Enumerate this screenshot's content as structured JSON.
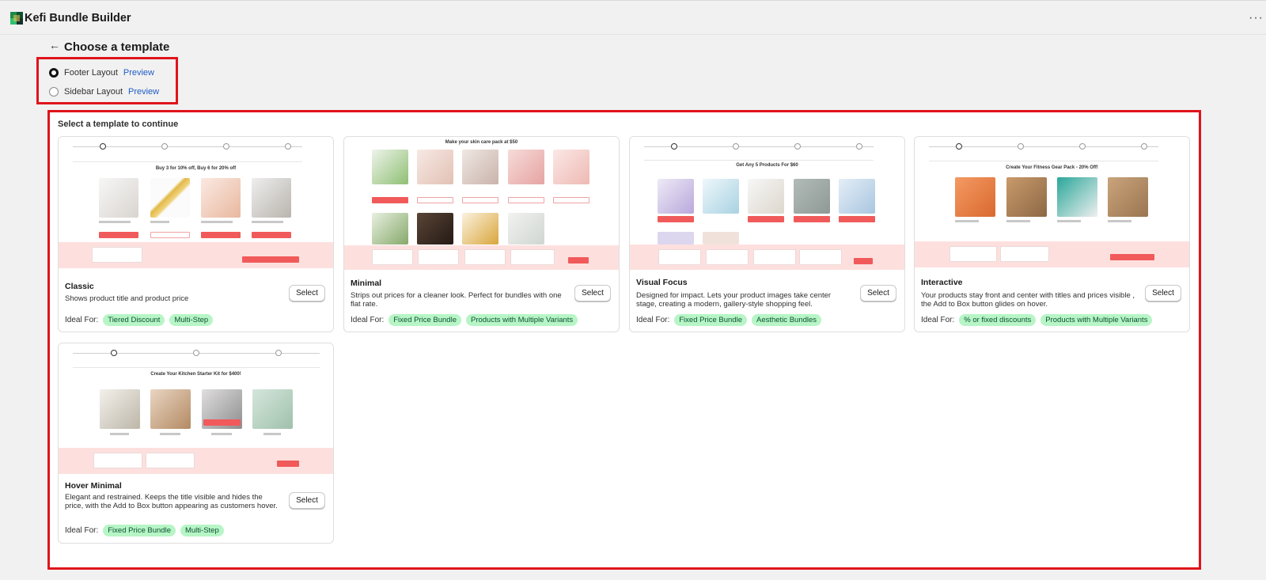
{
  "app": {
    "title": "Kefi Bundle Builder"
  },
  "page": {
    "title": "Choose a template"
  },
  "layout_options": [
    {
      "label": "Footer Layout",
      "preview": "Preview",
      "selected": true
    },
    {
      "label": "Sidebar Layout",
      "preview": "Preview",
      "selected": false
    }
  ],
  "section_label": "Select a template to continue",
  "ideal_for_label": "Ideal For:",
  "select_label": "Select",
  "cards": [
    {
      "title": "Classic",
      "desc": "Shows product title and product price",
      "tags": [
        "Tiered Discount",
        "Multi-Step"
      ],
      "thumb_heading": "Buy 3 for 10% off, Buy 6 for 20% off"
    },
    {
      "title": "Minimal",
      "desc": "Strips out prices for a cleaner look. Perfect for bundles with one flat rate.",
      "tags": [
        "Fixed Price Bundle",
        "Products with Multiple Variants"
      ],
      "thumb_heading": "Make your skin care pack at $50"
    },
    {
      "title": "Visual Focus",
      "desc": "Designed for impact. Lets your product images take center stage, creating a modern, gallery-style shopping feel.",
      "tags": [
        "Fixed Price Bundle",
        "Aesthetic Bundles"
      ],
      "thumb_heading": "Get Any 5 Products For $60"
    },
    {
      "title": "Interactive",
      "desc": "Your products stay front and center with titles and prices visible , the Add to Box button glides on hover.",
      "tags": [
        "% or fixed discounts",
        "Products with Multiple Variants"
      ],
      "thumb_heading": "Create Your Fitness Gear Pack - 20% Off!"
    },
    {
      "title": "Hover Minimal",
      "desc": "Elegant and restrained. Keeps the title visible and hides the price, with the Add to Box button appearing as customers hover.",
      "tags": [
        "Fixed Price Bundle",
        "Multi-Step"
      ],
      "thumb_heading": "Create Your Kitchen Starter Kit for $400!"
    }
  ],
  "colors": {
    "accent_red": "#e0141b",
    "tag_bg": "#b7f5c6",
    "tag_text": "#0c5132",
    "link": "#1e5cc7",
    "footer_band": "#fde0de",
    "button_coral": "#f15a5a"
  },
  "icons": [
    "app-logo-icon",
    "more-horizontal-icon",
    "arrow-left-icon"
  ]
}
